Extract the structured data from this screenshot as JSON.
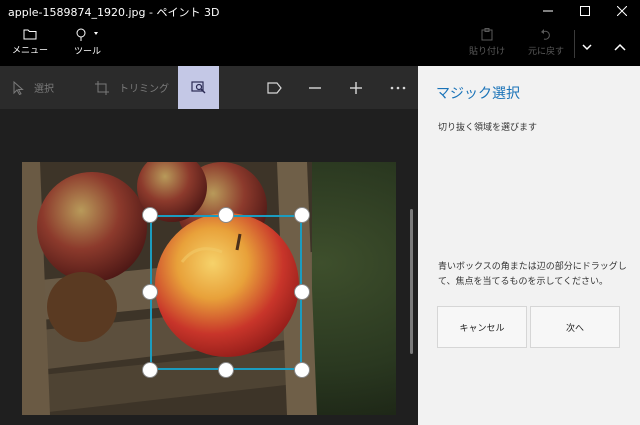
{
  "window": {
    "title": "apple-1589874_1920.jpg - ペイント 3D"
  },
  "ribbon": {
    "menu_label": "メニュー",
    "tools_label": "ツール",
    "paste_label": "貼り付け",
    "undo_label": "元に戻す"
  },
  "toolbar": {
    "select_label": "選択",
    "crop_label": "トリミング"
  },
  "panel": {
    "title": "マジック選択",
    "subtitle": "切り抜く領域を選びます",
    "help_text": "青いボックスの角または辺の部分にドラッグして、焦点を当てるものを示してください。",
    "cancel_label": "キャンセル",
    "next_label": "次へ"
  },
  "colors": {
    "accent": "#1a73b8",
    "selection_border": "#1b9cbf",
    "active_tool_bg": "#c4c8e6"
  },
  "icons": [
    "folder-icon",
    "tools-icon",
    "paste-icon",
    "undo-icon",
    "select-icon",
    "crop-icon",
    "magic-select-icon",
    "flag-icon",
    "zoom-out-icon",
    "zoom-in-icon",
    "more-icon",
    "chevron-down-icon",
    "chevron-up-icon",
    "minimize-icon",
    "maximize-icon",
    "close-icon"
  ]
}
